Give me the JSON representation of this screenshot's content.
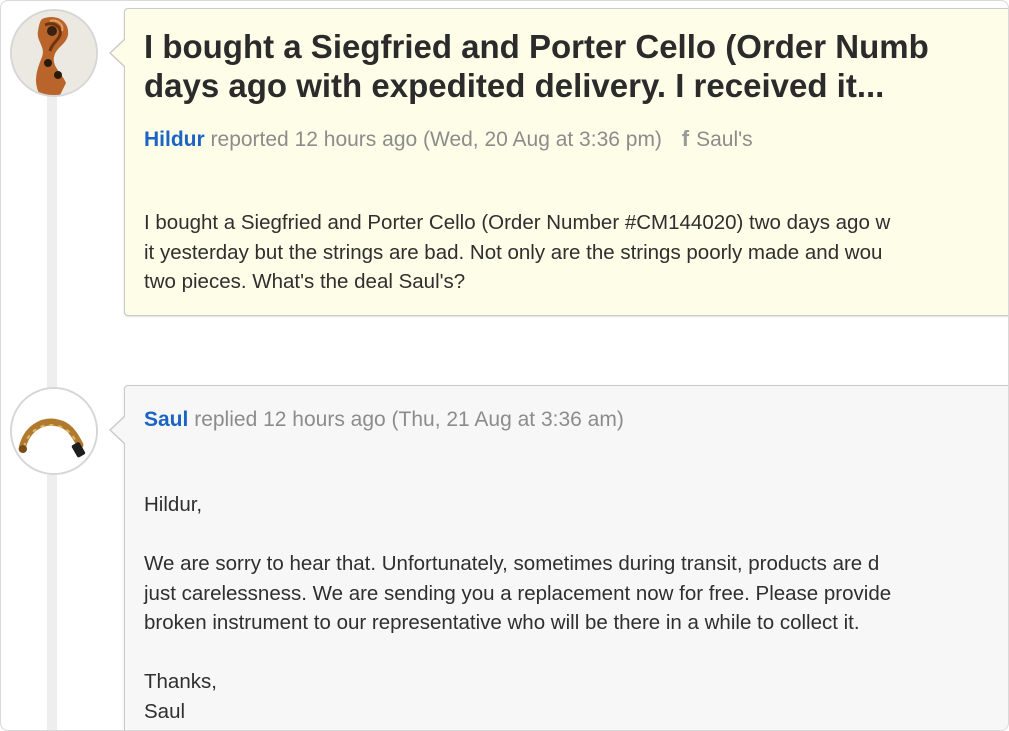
{
  "thread": {
    "report": {
      "title_lines": [
        "I bought a Siegfried and Porter Cello (Order Numb",
        "days ago with expedited delivery. I received it..."
      ],
      "author": "Hildur",
      "action": "reported",
      "time": "12 hours ago (Wed, 20 Aug at 3:36 pm)",
      "channel_icon": "facebook-icon",
      "channel_glyph": "f",
      "channel": "Saul's",
      "body_lines": [
        "I bought a Siegfried and Porter Cello (Order Number #CM144020) two days ago w",
        "it yesterday but the strings are bad. Not only are the strings poorly made and wou",
        "two pieces. What's the deal Saul's?"
      ]
    },
    "reply": {
      "author": "Saul",
      "action": "replied",
      "time": "12 hours ago (Thu, 21 Aug at 3:36 am)",
      "greeting": "Hildur,",
      "body_lines": [
        "We are sorry to hear that. Unfortunately, sometimes during transit, products are d",
        "just carelessness. We are sending you a replacement now for free. Please provide",
        "broken instrument to our representative who will be there in a while to collect it."
      ],
      "signoff": "Thanks,",
      "signature": "Saul"
    }
  },
  "colors": {
    "author_link": "#1a64c6",
    "meta_text": "#8c8c8c",
    "report_background": "#fdfde8",
    "reply_background": "#f7f7f7",
    "timeline": "#eeeeee"
  },
  "icons": {
    "hildur_avatar": "violin-scroll-avatar",
    "saul_avatar": "cello-bow-avatar"
  }
}
